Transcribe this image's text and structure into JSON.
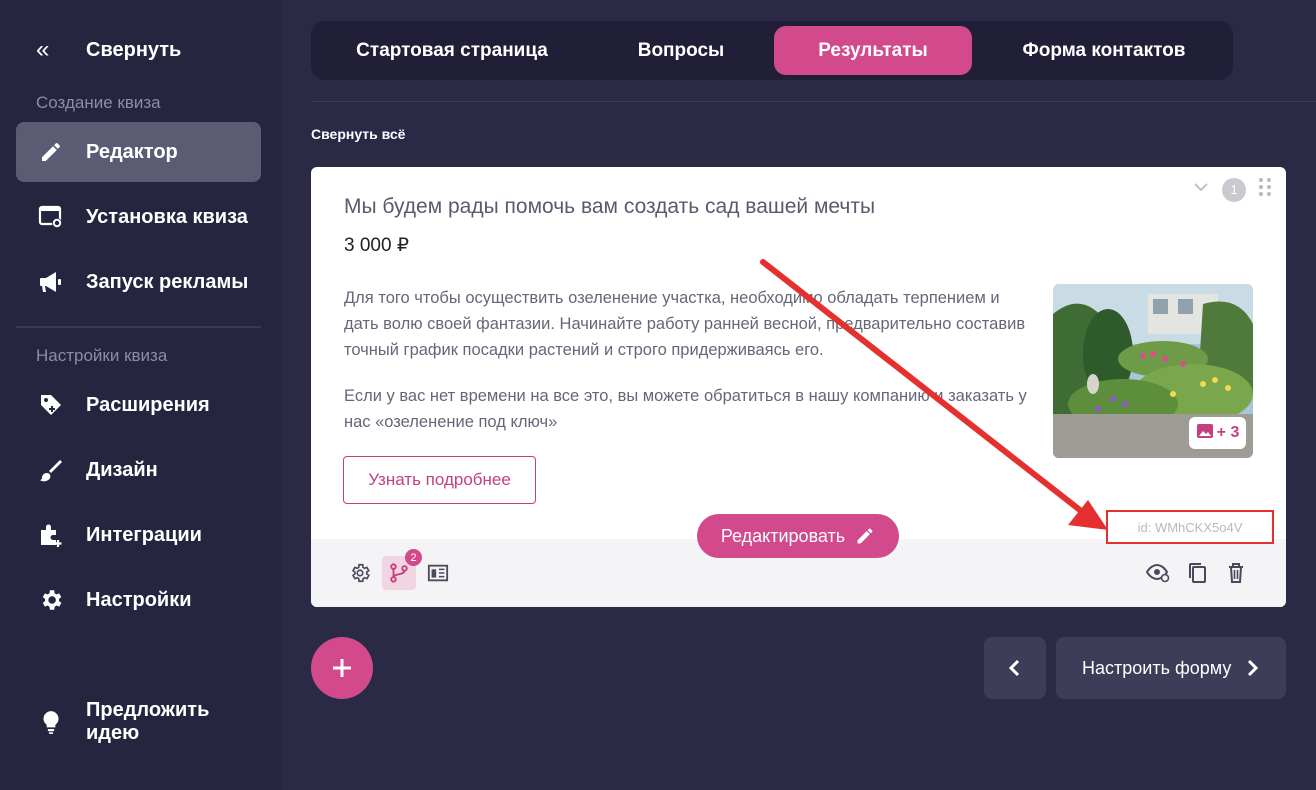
{
  "sidebar": {
    "collapse_label": "Свернуть",
    "section1_title": "Создание квиза",
    "items1": [
      {
        "label": "Редактор",
        "icon": "pencil-icon"
      },
      {
        "label": "Установка квиза",
        "icon": "window-settings-icon"
      },
      {
        "label": "Запуск рекламы",
        "icon": "megaphone-icon"
      }
    ],
    "section2_title": "Настройки квиза",
    "items2": [
      {
        "label": "Расширения",
        "icon": "tag-plus-icon"
      },
      {
        "label": "Дизайн",
        "icon": "brush-icon"
      },
      {
        "label": "Интеграции",
        "icon": "plugin-plus-icon"
      },
      {
        "label": "Настройки",
        "icon": "gear-icon"
      }
    ],
    "suggest_label": "Предложить идею"
  },
  "tabs": [
    "Стартовая страница",
    "Вопросы",
    "Результаты",
    "Форма контактов"
  ],
  "active_tab": "Результаты",
  "collapse_all": "Свернуть всё",
  "card": {
    "title": "Мы будем рады помочь вам создать сад вашей мечты",
    "price": "3 000 ₽",
    "paragraph1": "Для того чтобы осуществить озеленение участка, необходимо обладать терпением и дать волю своей фантазии. Начинайте работу ранней весной, предварительно составив точный график посадки растений и строго придерживаясь его.",
    "paragraph2": "Если у вас нет времени на все это, вы можете обратиться в нашу компанию и заказать у нас «озеленение под ключ»",
    "button_label": "Узнать подробнее",
    "image_badge": "+ 3",
    "number": "1",
    "edit_label": "Редактировать",
    "id_label": "id: WMhCKX5o4V",
    "branch_count": "2"
  },
  "next_label": "Настроить форму",
  "colors": {
    "accent": "#d24a8c",
    "sidebar": "#26253f",
    "background": "#2b2a46",
    "highlight_box": "#e53030"
  }
}
